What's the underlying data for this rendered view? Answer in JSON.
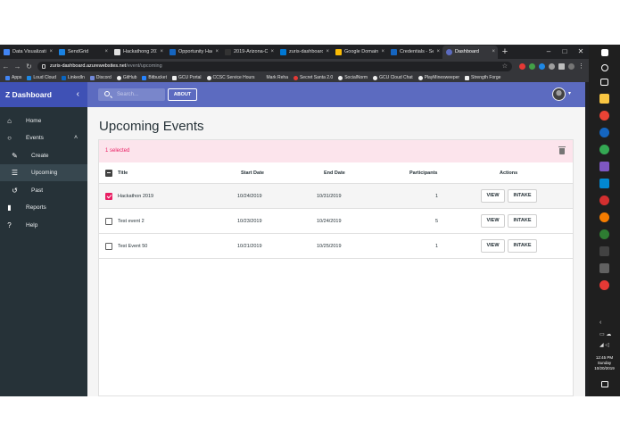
{
  "browser": {
    "tabs": [
      {
        "label": "Data Visualizatio",
        "color": "#4285f4"
      },
      {
        "label": "SendGrid",
        "color": "#1a82e2"
      },
      {
        "label": "Hackathong 2019",
        "color": "#e0e0e0"
      },
      {
        "label": "Opportunity Hac",
        "color": "#1565c0"
      },
      {
        "label": "2019-Arizona-Ca",
        "color": "#333333"
      },
      {
        "label": "zuris-dashboard",
        "color": "#0078d4"
      },
      {
        "label": "Google Domain",
        "color": "#fbbc05"
      },
      {
        "label": "Credentials - Sec",
        "color": "#1565c0"
      },
      {
        "label": "Dashboard",
        "color": "#5c6bc0"
      }
    ],
    "new_tab": "+",
    "window_controls": {
      "minimize": "–",
      "maximize": "□",
      "close": "✕"
    },
    "url_host": "zuris-dashboard.azurewebsites.net",
    "url_path": "/event/upcoming",
    "bookmarks": [
      {
        "label": "Apps",
        "color": "#4285f4"
      },
      {
        "label": "Loud Cloud",
        "color": "#1e88e5"
      },
      {
        "label": "LinkedIn",
        "color": "#0a66c2"
      },
      {
        "label": "Discord",
        "color": "#7289da"
      },
      {
        "label": "GitHub",
        "color": "#eeeeee"
      },
      {
        "label": "Bitbucket",
        "color": "#2684ff"
      },
      {
        "label": "GCU Portal",
        "color": "#eeeeee"
      },
      {
        "label": "CCSC Service Hours",
        "color": "#eeeeee"
      },
      {
        "label": "Mark Reha",
        "color": "#eeeeee"
      },
      {
        "label": "Secret Santa 2.0",
        "color": "#e53935"
      },
      {
        "label": "SocialNorm",
        "color": "#eeeeee"
      },
      {
        "label": "GCU Cloud Chat",
        "color": "#eeeeee"
      },
      {
        "label": "PlayMinesweeper",
        "color": "#eeeeee"
      },
      {
        "label": "Strength Forge",
        "color": "#eeeeee"
      }
    ]
  },
  "app": {
    "brand": "Z Dashboard",
    "collapse_icon": "‹",
    "search_placeholder": "Search...",
    "about_label": "ABOUT",
    "accent": "#5c6bc0",
    "sidebar": {
      "items": [
        {
          "label": "Home",
          "icon": "⌂"
        },
        {
          "label": "Events",
          "icon": "○",
          "caret": "˄"
        },
        {
          "label": "Create",
          "icon": "✎"
        },
        {
          "label": "Upcoming",
          "icon": "☰"
        },
        {
          "label": "Past",
          "icon": "↺"
        },
        {
          "label": "Reports",
          "icon": "▮"
        },
        {
          "label": "Help",
          "icon": "?"
        }
      ]
    },
    "page_title": "Upcoming Events",
    "selected_text": "1 selected",
    "table": {
      "headers": {
        "title": "Title",
        "start": "Start Date",
        "end": "End Date",
        "participants": "Participants",
        "actions": "Actions"
      },
      "rows": [
        {
          "title": "Hackathon 2019",
          "start": "10/24/2019",
          "end": "10/31/2019",
          "participants": "1",
          "selected": true
        },
        {
          "title": "Test event 2",
          "start": "10/23/2019",
          "end": "10/24/2019",
          "participants": "5",
          "selected": false
        },
        {
          "title": "Test Event 50",
          "start": "10/21/2019",
          "end": "10/25/2019",
          "participants": "1",
          "selected": false
        }
      ],
      "view_label": "VIEW",
      "intake_label": "INTAKE"
    }
  },
  "taskbar": {
    "time": "12:45 PM",
    "day": "Sunday",
    "date": "10/20/2019"
  }
}
